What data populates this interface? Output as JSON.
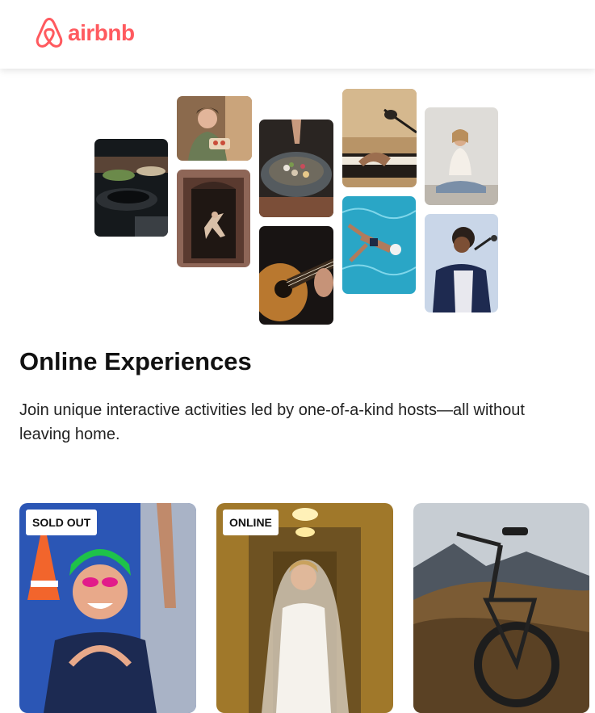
{
  "nav": {
    "logo_text": "airbnb",
    "logo_icon": "airbnb-belo-icon",
    "brand_color": "#ff5a5f"
  },
  "hero": {
    "photos": [
      "cooking-pans",
      "woman-holding-food",
      "dancer-in-doorway",
      "food-bowl",
      "guitar-playing",
      "microphone-keyboard",
      "swimmer-pool",
      "yoga-meditation",
      "singer-microphone"
    ]
  },
  "main": {
    "title": "Online Experiences",
    "description": "Join unique interactive activities led by one-of-a-kind hosts—all without leaving home."
  },
  "cards": [
    {
      "badge": "SOLD OUT",
      "image": "swimmer-portrait"
    },
    {
      "badge": "ONLINE",
      "image": "bride-portrait"
    },
    {
      "badge": "",
      "image": "mountain-bike"
    }
  ]
}
